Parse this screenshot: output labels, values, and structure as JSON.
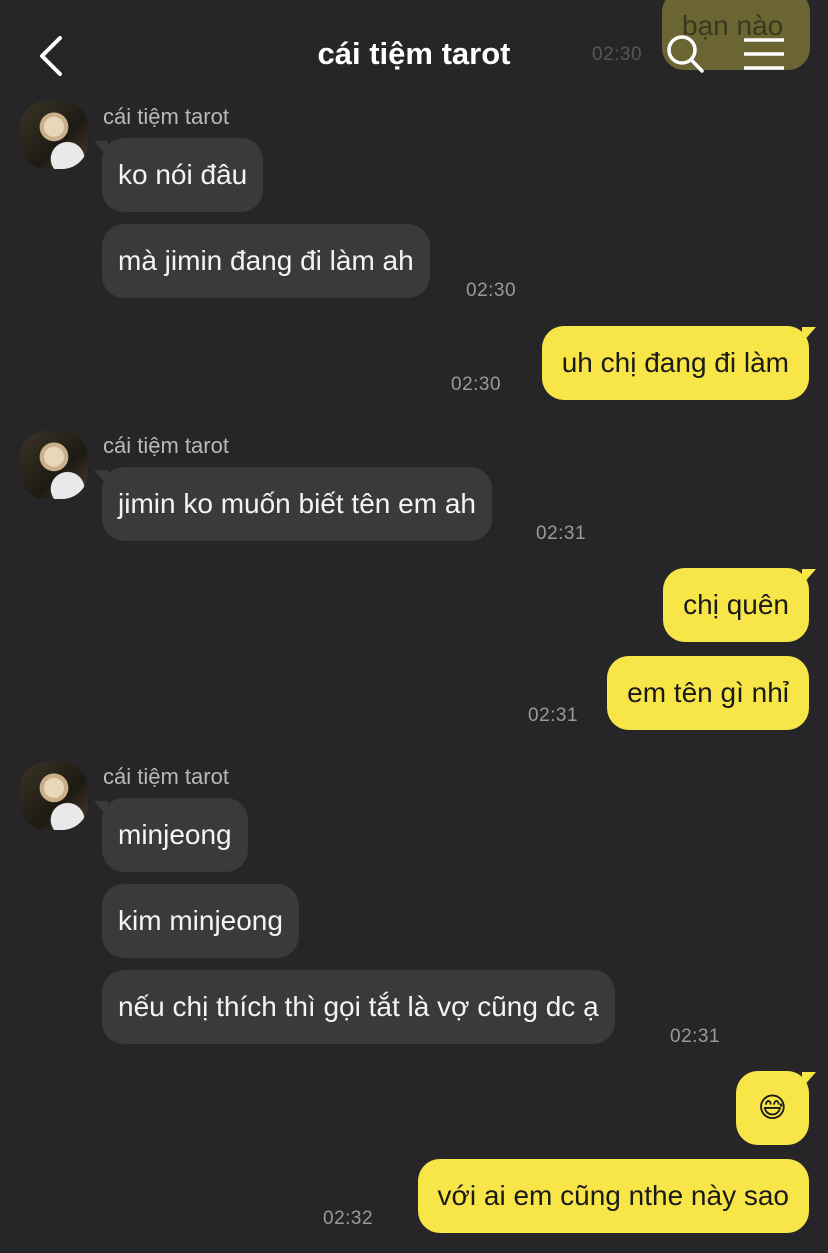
{
  "header": {
    "title": "cái tiệm tarot",
    "faded_prev_message": "bạn nào",
    "faded_prev_time": "02:30"
  },
  "sender_name": "cái tiệm tarot",
  "messages": [
    {
      "text": "ko nói đâu"
    },
    {
      "text": "mà jimin đang đi làm ah",
      "time": "02:30"
    },
    {
      "text": "uh chị đang đi làm",
      "time": "02:30"
    },
    {
      "text": "jimin ko muốn biết tên em ah",
      "time": "02:31"
    },
    {
      "text": "chị quên"
    },
    {
      "text": "em tên gì nhỉ",
      "time": "02:31"
    },
    {
      "text": "minjeong"
    },
    {
      "text": "kim minjeong"
    },
    {
      "text": "nếu chị thích thì gọi tắt là vợ cũng dc ạ",
      "time": "02:31"
    },
    {
      "text": "😅"
    },
    {
      "text": "với ai em cũng nthe này sao",
      "time": "02:32"
    }
  ],
  "icons": {
    "back": "chevron-left",
    "search": "magnifier",
    "menu": "hamburger"
  },
  "colors": {
    "background": "#262628",
    "incoming_bubble": "#3a3a3d",
    "outgoing_bubble": "#f8e547"
  }
}
